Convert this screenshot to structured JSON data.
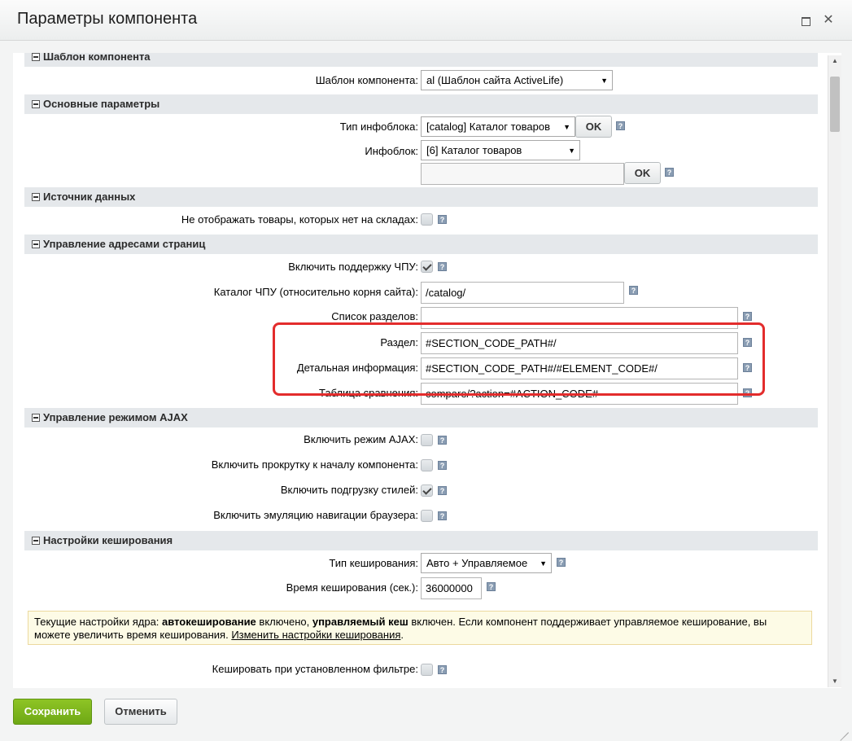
{
  "window": {
    "title": "Параметры компонента"
  },
  "sections": {
    "template": "Шаблон компонента",
    "basic": "Основные параметры",
    "data_source": "Источник данных",
    "sef": "Управление адресами страниц",
    "ajax": "Управление режимом AJAX",
    "cache": "Настройки кеширования"
  },
  "fields": {
    "template_label": "Шаблон компонента:",
    "template_value": "al (Шаблон сайта ActiveLife)",
    "iblock_type_label": "Тип инфоблока:",
    "iblock_type_value": "[catalog] Каталог товаров",
    "iblock_label": "Инфоблок:",
    "iblock_value": "[6] Каталог товаров",
    "iblock_extra_value": "",
    "hide_not_available_label": "Не отображать товары, которых нет на складах:",
    "hide_not_available_checked": false,
    "sef_mode_label": "Включить поддержку ЧПУ:",
    "sef_mode_checked": true,
    "sef_folder_label": "Каталог ЧПУ (относительно корня сайта):",
    "sef_folder_value": "/catalog/",
    "sections_list_label": "Список разделов:",
    "sections_list_value": "",
    "section_label": "Раздел:",
    "section_value": "#SECTION_CODE_PATH#/",
    "element_label": "Детальная информация:",
    "element_value": "#SECTION_CODE_PATH#/#ELEMENT_CODE#/",
    "compare_label": "Таблица сравнения:",
    "compare_value": "compare/?action=#ACTION_CODE#",
    "ajax_mode_label": "Включить режим AJAX:",
    "ajax_mode_checked": false,
    "ajax_scroll_label": "Включить прокрутку к началу компонента:",
    "ajax_scroll_checked": false,
    "ajax_styles_label": "Включить подгрузку стилей:",
    "ajax_styles_checked": true,
    "ajax_history_label": "Включить эмуляцию навигации браузера:",
    "ajax_history_checked": false,
    "cache_type_label": "Тип кеширования:",
    "cache_type_value": "Авто + Управляемое",
    "cache_time_label": "Время кеширования (сек.):",
    "cache_time_value": "36000000",
    "cache_filter_label": "Кешировать при установленном фильтре:",
    "cache_filter_checked": false
  },
  "note": {
    "part1": "Текущие настройки ядра: ",
    "bold1": "автокеширование",
    "part2": " включено, ",
    "bold2": "управляемый кеш",
    "part3": " включен. Если компонент поддерживает управляемое кеширование, вы можете увеличить время кеширования. ",
    "link": "Изменить настройки кеширования",
    "part4": "."
  },
  "buttons": {
    "ok": "OK",
    "help": "?",
    "save": "Сохранить",
    "cancel": "Отменить"
  },
  "colors": {
    "highlight": "#e32c2c",
    "save_button": "#7ab51d",
    "section_bg": "#e5e8eb",
    "note_bg": "#fdfbe6"
  }
}
